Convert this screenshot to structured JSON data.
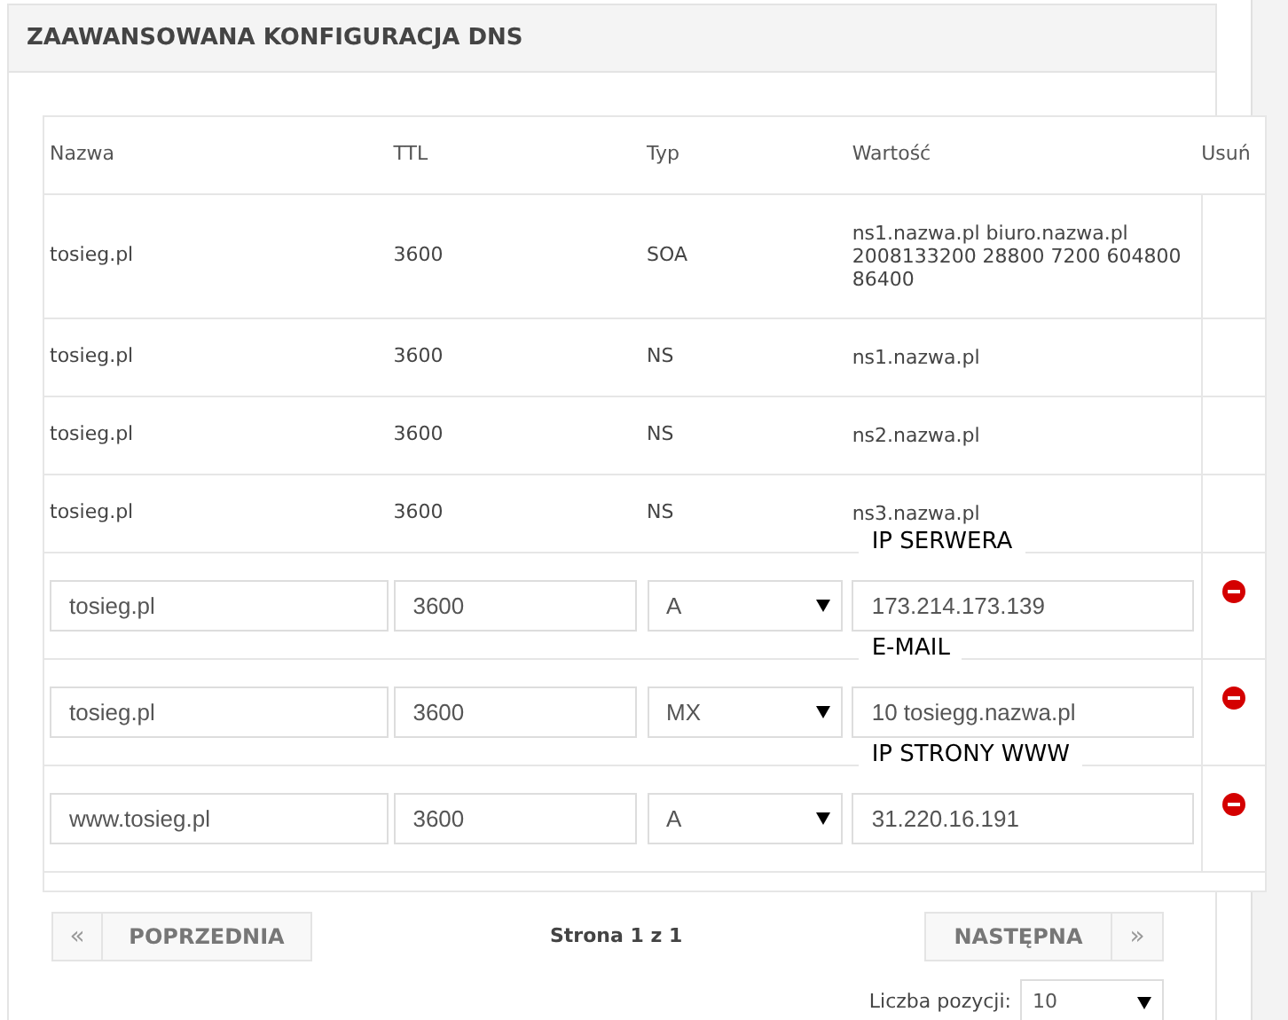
{
  "panel": {
    "title": "ZAAWANSOWANA KONFIGURACJA DNS"
  },
  "table": {
    "columns": [
      "Nazwa",
      "TTL",
      "Typ",
      "Wartość",
      "Usuń"
    ],
    "rows": [
      {
        "kind": "static",
        "name": "tosieg.pl",
        "ttl": "3600",
        "type": "SOA",
        "value": "ns1.nazwa.pl biuro.nazwa.pl 2008133200 28800 7200 604800 86400"
      },
      {
        "kind": "static",
        "name": "tosieg.pl",
        "ttl": "3600",
        "type": "NS",
        "value": "ns1.nazwa.pl"
      },
      {
        "kind": "static",
        "name": "tosieg.pl",
        "ttl": "3600",
        "type": "NS",
        "value": "ns2.nazwa.pl"
      },
      {
        "kind": "static",
        "name": "tosieg.pl",
        "ttl": "3600",
        "type": "NS",
        "value": "ns3.nazwa.pl"
      },
      {
        "kind": "editable",
        "name": "tosieg.pl",
        "ttl": "3600",
        "type": "A",
        "value": "173.214.173.139",
        "note": "IP SERWERA"
      },
      {
        "kind": "editable",
        "name": "tosieg.pl",
        "ttl": "3600",
        "type": "MX",
        "value": "10 tosiegg.nazwa.pl",
        "note": "E-MAIL"
      },
      {
        "kind": "editable",
        "name": "www.tosieg.pl",
        "ttl": "3600",
        "type": "A",
        "value": "31.220.16.191",
        "note": "IP STRONY WWW"
      }
    ]
  },
  "pagination": {
    "prev_arrow": "«",
    "prev": "POPRZEDNIA",
    "page": "Strona 1 z 1",
    "next": "NASTĘPNA",
    "next_arrow": "»",
    "per_page_label": "Liczba pozycji:",
    "per_page": "10"
  }
}
